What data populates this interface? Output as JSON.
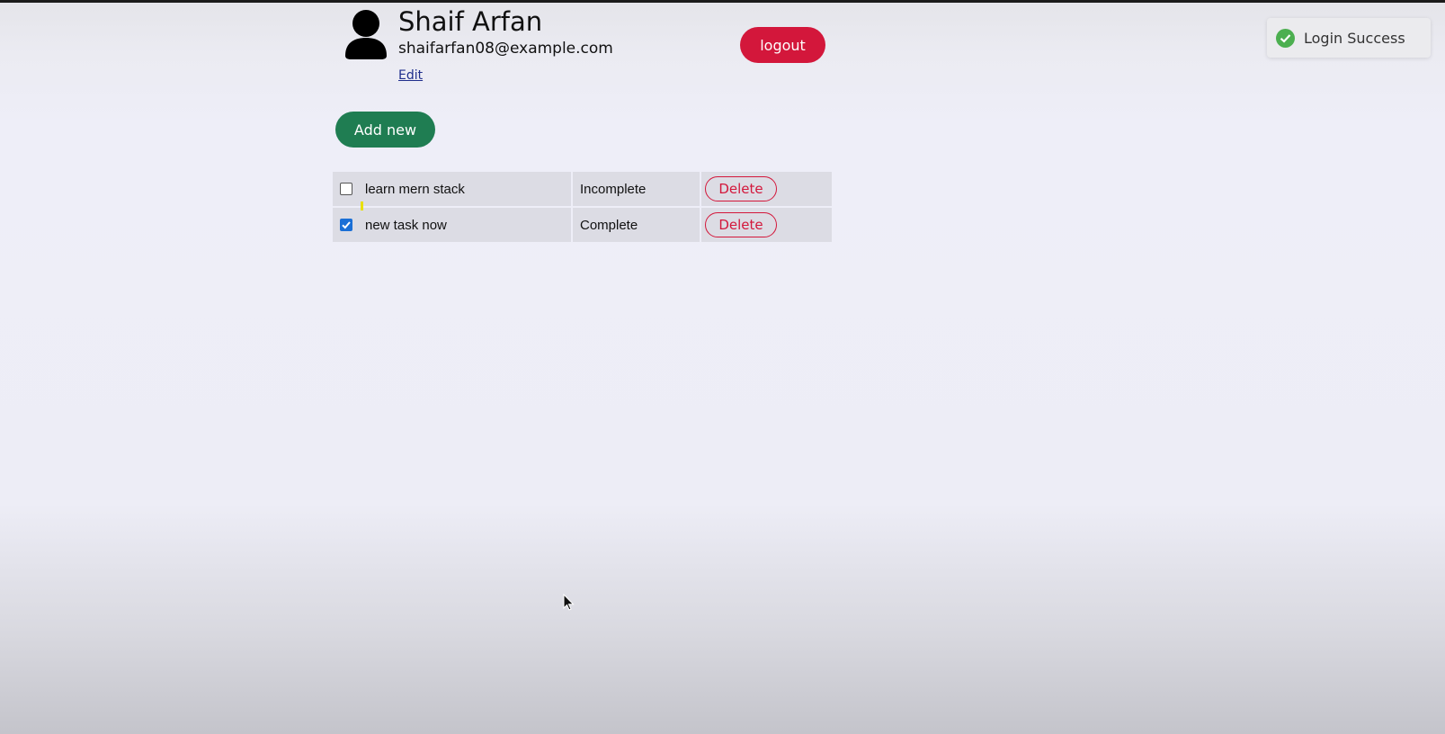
{
  "user": {
    "name": "Shaif Arfan",
    "email": "shaifarfan08@example.com",
    "edit_label": "Edit",
    "avatar_icon": "user-avatar-icon"
  },
  "actions": {
    "logout_label": "logout",
    "add_new_label": "Add new"
  },
  "tasks": [
    {
      "title": "learn mern stack",
      "status": "Incomplete",
      "checked": false,
      "delete_label": "Delete"
    },
    {
      "title": "new task now",
      "status": "Complete",
      "checked": true,
      "delete_label": "Delete"
    }
  ],
  "toast": {
    "message": "Login Success",
    "icon": "check-circle-icon"
  },
  "colors": {
    "logout": "#d3173b",
    "add_new": "#1f7d52",
    "delete": "#d3173b",
    "checkbox_checked": "#1a6fd6",
    "toast_success": "#4caf50"
  }
}
